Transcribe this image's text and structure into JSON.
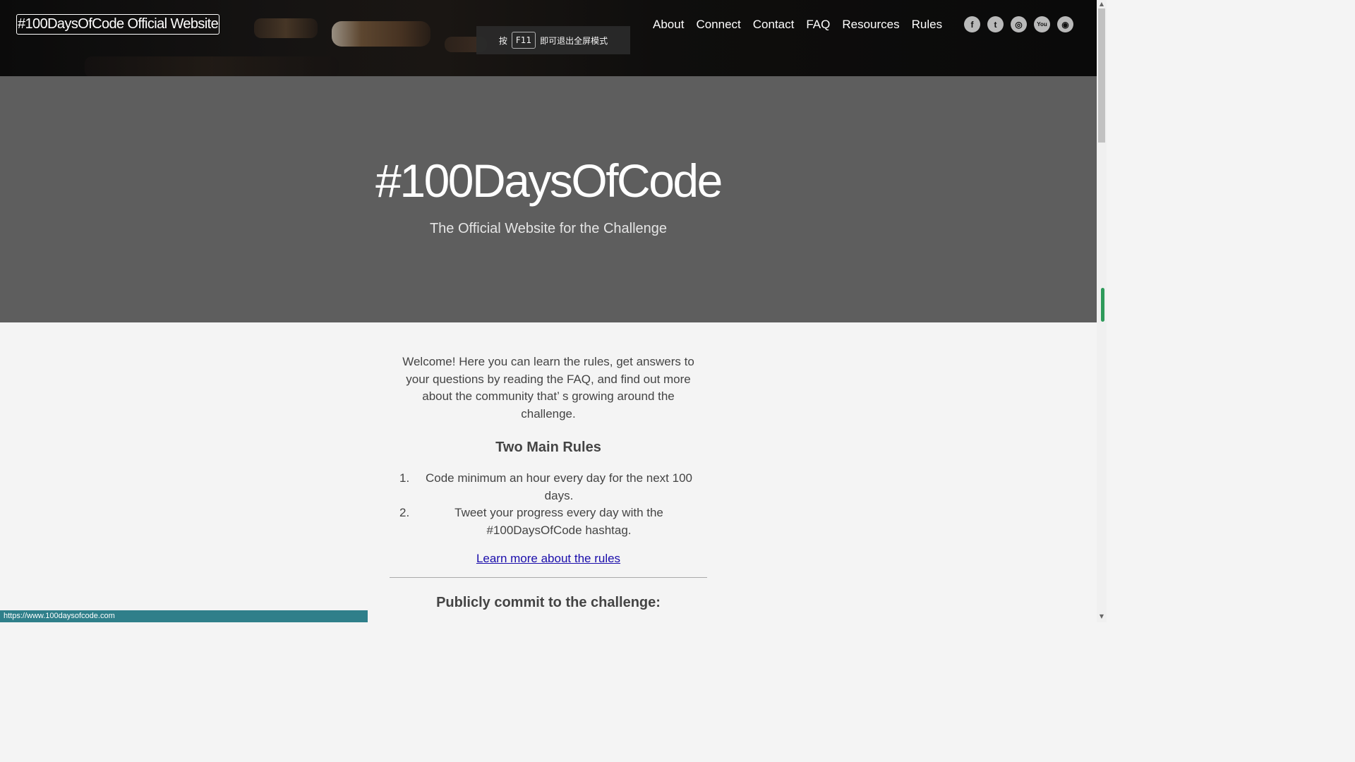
{
  "header": {
    "brand": "#100DaysOfCode Official Website",
    "nav": [
      {
        "label": "About"
      },
      {
        "label": "Connect"
      },
      {
        "label": "Contact"
      },
      {
        "label": "FAQ"
      },
      {
        "label": "Resources"
      },
      {
        "label": "Rules"
      }
    ],
    "socials": [
      {
        "icon": "facebook-icon",
        "glyph": "f"
      },
      {
        "icon": "twitter-icon",
        "glyph": "t"
      },
      {
        "icon": "instagram-icon",
        "glyph": "◎"
      },
      {
        "icon": "youtube-icon",
        "glyph": "You"
      },
      {
        "icon": "github-icon",
        "glyph": "◉"
      }
    ]
  },
  "fullscreen_toast": {
    "prefix": "按",
    "key": "F11",
    "suffix": "即可退出全屏模式"
  },
  "hero": {
    "title": "#100DaysOfCode",
    "subtitle": "The Official Website for the Challenge"
  },
  "content": {
    "welcome": "Welcome! Here you can learn the rules, get answers to your questions by reading the FAQ, and find out more about the community that’ s growing around the challenge.",
    "rules_heading": "Two Main Rules",
    "rules": [
      {
        "num": "1.",
        "text": "Code minimum an hour every day for the next 100 days."
      },
      {
        "num": "2.",
        "text": "Tweet your progress every day with the #100DaysOfCode hashtag."
      }
    ],
    "rules_link": "Learn more about the rules",
    "commit_heading": "Publicly commit to the challenge:"
  },
  "status_bar": {
    "url": "https://www.100daysofcode.com"
  }
}
